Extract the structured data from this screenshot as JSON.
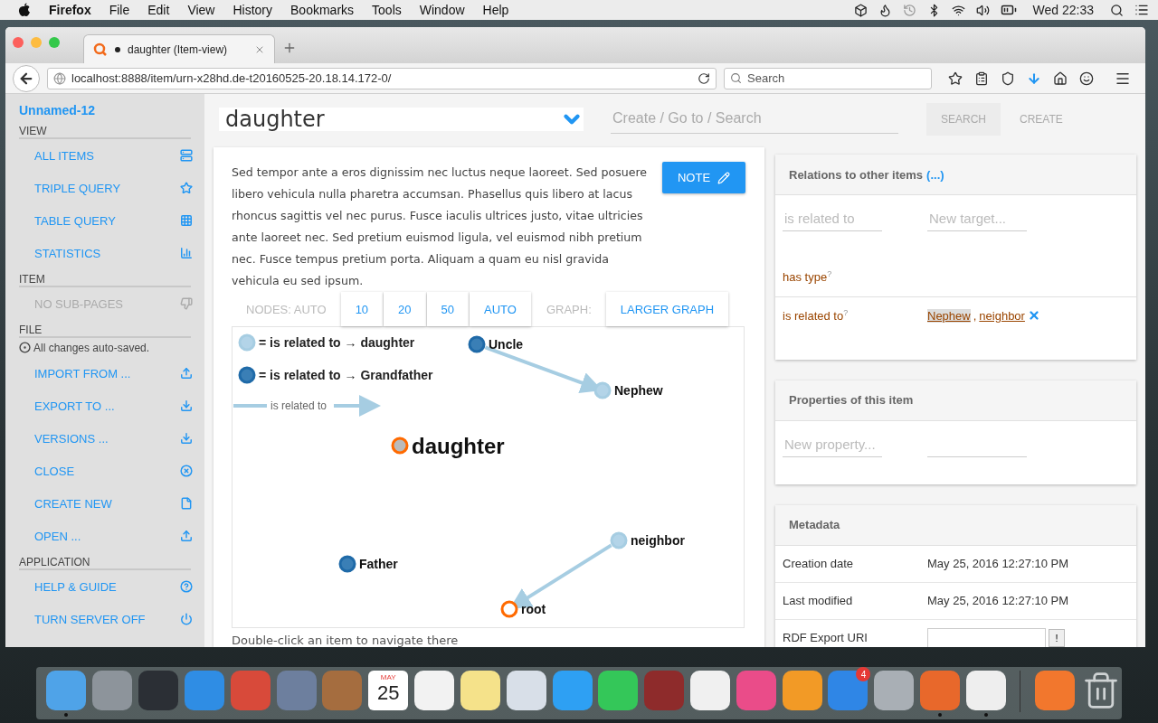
{
  "menubar": {
    "app": "Firefox",
    "menus": [
      "File",
      "Edit",
      "View",
      "History",
      "Bookmarks",
      "Tools",
      "Window",
      "Help"
    ],
    "clock": "Wed 22:33"
  },
  "browser": {
    "tab_title": "daughter (Item-view)",
    "url": "localhost:8888/item/urn-x28hd.de-t20160525-20.18.14.172-0/",
    "search_placeholder": "Search"
  },
  "sidebar": {
    "title": "Unnamed-12",
    "sections": [
      {
        "heading": "VIEW",
        "items": [
          {
            "label": "ALL ITEMS",
            "disabled": false
          },
          {
            "label": "TRIPLE QUERY",
            "disabled": false
          },
          {
            "label": "TABLE QUERY",
            "disabled": false
          },
          {
            "label": "STATISTICS",
            "disabled": false
          }
        ]
      },
      {
        "heading": "ITEM",
        "items": [
          {
            "label": "NO SUB-PAGES",
            "disabled": true
          }
        ]
      },
      {
        "heading": "FILE",
        "note": "All changes auto-saved.",
        "items": [
          {
            "label": "IMPORT FROM ...",
            "disabled": false
          },
          {
            "label": "EXPORT TO ...",
            "disabled": false
          },
          {
            "label": "VERSIONS ...",
            "disabled": false
          },
          {
            "label": "CLOSE",
            "disabled": false
          },
          {
            "label": "CREATE NEW",
            "disabled": false
          },
          {
            "label": "OPEN ...",
            "disabled": false
          }
        ]
      },
      {
        "heading": "APPLICATION",
        "items": [
          {
            "label": "HELP & GUIDE",
            "disabled": false
          },
          {
            "label": "TURN SERVER OFF",
            "disabled": false
          }
        ]
      }
    ]
  },
  "header": {
    "title": "daughter",
    "search_placeholder": "Create / Go to / Search",
    "buttons": [
      {
        "label": "SEARCH",
        "kind": "filled"
      },
      {
        "label": "CREATE",
        "kind": "flat"
      }
    ]
  },
  "note": {
    "text": "Sed tempor ante a eros dignissim nec luctus neque laoreet. Sed posuere libero vehicula nulla pharetra accumsan. Phasellus quis libero at lacus rhoncus sagittis vel nec purus. Fusce iaculis ultrices justo, vitae ultricies ante laoreet nec. Sed pretium euismod ligula, vel euismod nibh pretium nec. Fusce tempus pretium porta. Aliquam a quam eu nisl gravida vehicula eu sed ipsum.",
    "button": "NOTE"
  },
  "graph_toolbar": {
    "nodes_label": "NODES: AUTO",
    "counts": [
      "10",
      "20",
      "50",
      "AUTO"
    ],
    "graph_label": "GRAPH:",
    "larger": "LARGER GRAPH"
  },
  "graph": {
    "legend": [
      {
        "kind": "light",
        "label": "= is related to → daughter"
      },
      {
        "kind": "dark",
        "label": "= is related to → Grandfather"
      }
    ],
    "edge_key": "is related to",
    "nodes": [
      {
        "label": "Uncle",
        "kind": "dark"
      },
      {
        "label": "Nephew",
        "kind": "light"
      },
      {
        "label": "daughter",
        "kind": "focus"
      },
      {
        "label": "neighbor",
        "kind": "light"
      },
      {
        "label": "Father",
        "kind": "dark"
      },
      {
        "label": "root",
        "kind": "root"
      }
    ]
  },
  "caption": "Double-click an item to navigate there",
  "relations": {
    "title": "Relations to other items",
    "more": "(...)",
    "predicate_placeholder": "is related to",
    "target_placeholder": "New target...",
    "rows": [
      {
        "label": "has type$^{?}$"
      },
      {
        "label": "is related to$^{?}$",
        "separator": ",",
        "targets": [
          {
            "label": "Nephew",
            "highlighted": true
          },
          {
            "label": "neighbor",
            "highlighted": false
          }
        ]
      }
    ]
  },
  "properties": {
    "title": "Properties of this item",
    "placeholder": "New property..."
  },
  "metadata": {
    "title": "Metadata",
    "rows": [
      {
        "kind": "text",
        "label": "Creation date",
        "value": "May 25, 2016 12:27:10 PM"
      },
      {
        "kind": "text",
        "label": "Last modified",
        "value": "May 25, 2016 12:27:10 PM"
      },
      {
        "kind": "input",
        "label": "RDF Export URI",
        "button": "!"
      }
    ]
  },
  "dock": {
    "apps": [
      {
        "kind": "app",
        "running": true
      },
      {
        "kind": "app",
        "running": false
      },
      {
        "kind": "app",
        "running": false
      },
      {
        "kind": "app",
        "running": false
      },
      {
        "kind": "app",
        "running": false
      },
      {
        "kind": "app",
        "running": false
      },
      {
        "kind": "app",
        "running": false
      },
      {
        "kind": "calendar",
        "month": "MAY",
        "day": "25",
        "running": false
      },
      {
        "kind": "app",
        "running": false
      },
      {
        "kind": "app",
        "running": false
      },
      {
        "kind": "app",
        "running": false
      },
      {
        "kind": "app",
        "running": false
      },
      {
        "kind": "app",
        "running": false
      },
      {
        "kind": "app",
        "running": false
      },
      {
        "kind": "app",
        "running": false
      },
      {
        "kind": "app",
        "running": false
      },
      {
        "kind": "app",
        "running": false
      },
      {
        "kind": "app",
        "badge": "4",
        "running": false
      },
      {
        "kind": "app",
        "running": false
      },
      {
        "kind": "app",
        "running": true
      },
      {
        "kind": "app",
        "running": true
      }
    ],
    "extras": [
      {
        "kind": "app",
        "running": false
      },
      {
        "kind": "trash",
        "running": false
      }
    ]
  }
}
